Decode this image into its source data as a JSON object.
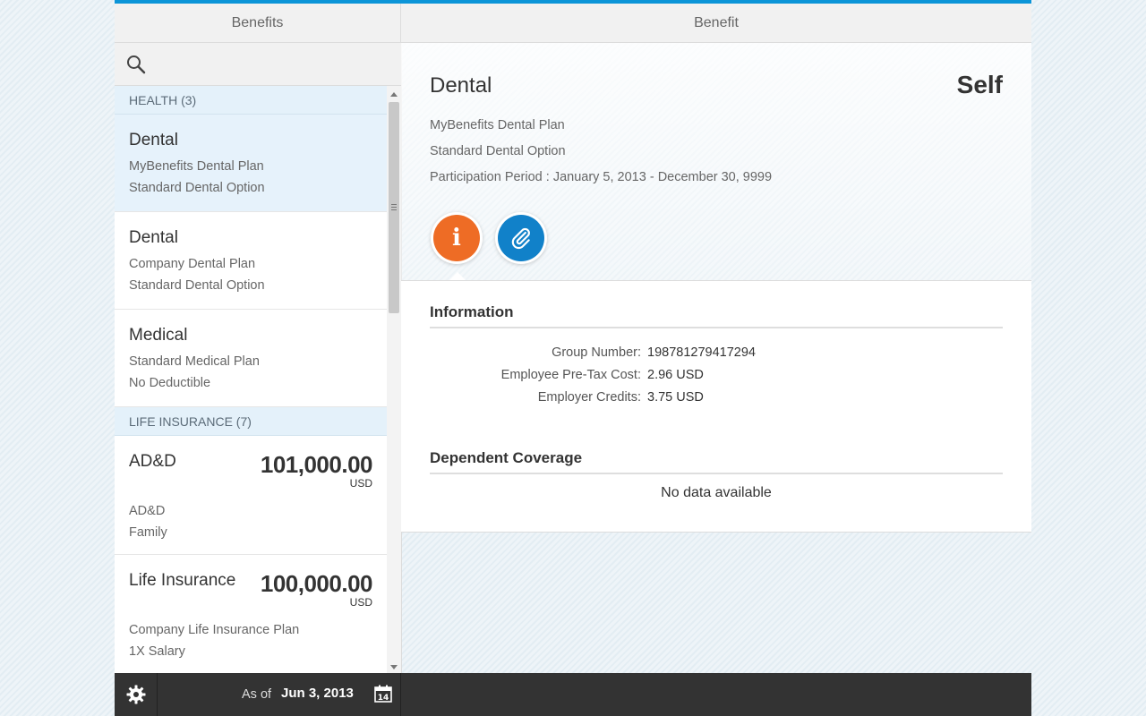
{
  "header": {
    "left_title": "Benefits",
    "right_title": "Benefit"
  },
  "search": {
    "icon": "search-icon"
  },
  "list": {
    "groups": [
      {
        "label": "HEALTH (3)",
        "items": [
          {
            "title": "Dental",
            "line1": "MyBenefits Dental Plan",
            "line2": "Standard Dental Option",
            "selected": true
          },
          {
            "title": "Dental",
            "line1": "Company Dental Plan",
            "line2": "Standard Dental Option"
          },
          {
            "title": "Medical",
            "line1": "Standard Medical Plan",
            "line2": "No Deductible"
          }
        ]
      },
      {
        "label": "LIFE INSURANCE (7)",
        "items": [
          {
            "title": "AD&D",
            "amount": "101,000.00",
            "currency": "USD",
            "line1": "AD&D",
            "line2": "Family"
          },
          {
            "title": "Life Insurance",
            "amount": "100,000.00",
            "currency": "USD",
            "line1": "Company Life Insurance Plan",
            "line2": "1X Salary"
          }
        ]
      }
    ]
  },
  "detail": {
    "title": "Dental",
    "coverage": "Self",
    "plan": "MyBenefits Dental Plan",
    "option": "Standard Dental Option",
    "period": "Participation Period : January 5, 2013 - December 30, 9999",
    "info_button_glyph": "i",
    "info_section": "Information",
    "fields": [
      {
        "label": "Group Number:",
        "value": "198781279417294"
      },
      {
        "label": "Employee Pre-Tax Cost:",
        "value": "2.96 USD"
      },
      {
        "label": "Employer Credits:",
        "value": "3.75 USD"
      }
    ],
    "dependent_section": "Dependent Coverage",
    "no_data": "No data available"
  },
  "footer": {
    "as_of": "As of",
    "date": "Jun 3, 2013",
    "calendar_day": "14"
  },
  "colors": {
    "accent": "#0c95d8",
    "info_button": "#ee6c25",
    "attach_button": "#1181c9",
    "footer": "#333333"
  }
}
